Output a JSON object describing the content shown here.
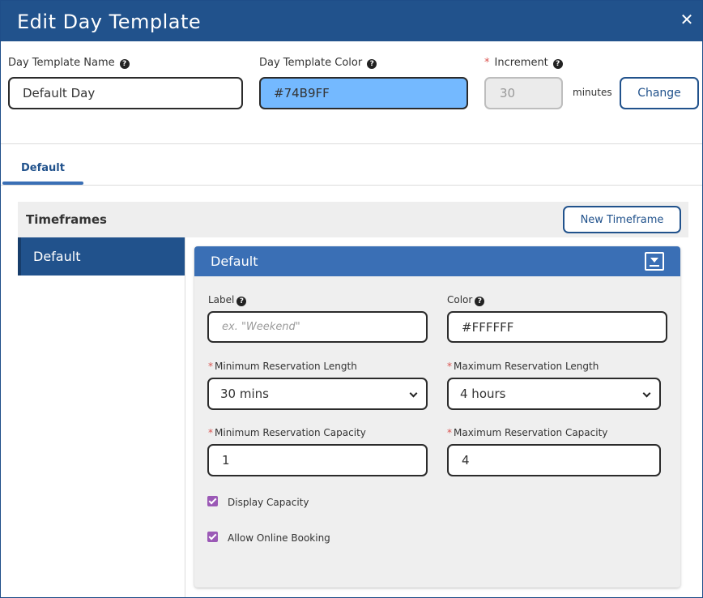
{
  "header": {
    "title": "Edit Day Template",
    "close_glyph": "✕"
  },
  "form": {
    "name_label": "Day Template Name",
    "name_value": "Default Day",
    "color_label": "Day Template Color",
    "color_value": "#74B9FF",
    "increment_label": "Increment",
    "increment_value": "30",
    "increment_unit": "minutes",
    "change_button": "Change",
    "help_glyph": "?"
  },
  "tabs": [
    {
      "label": "Default",
      "active": true
    }
  ],
  "timeframes": {
    "title": "Timeframes",
    "new_button": "New Timeframe",
    "items": [
      {
        "label": "Default",
        "selected": true
      }
    ]
  },
  "panel": {
    "title": "Default",
    "label_field": {
      "label": "Label",
      "placeholder": "ex. \"Weekend\""
    },
    "color_field": {
      "label": "Color",
      "value": "#FFFFFF"
    },
    "min_length": {
      "label": "Minimum Reservation Length",
      "value": "30 mins"
    },
    "max_length": {
      "label": "Maximum Reservation Length",
      "value": "4 hours"
    },
    "min_capacity": {
      "label": "Minimum Reservation Capacity",
      "value": "1"
    },
    "max_capacity": {
      "label": "Maximum Reservation Capacity",
      "value": "4"
    },
    "display_capacity": {
      "label": "Display Capacity",
      "checked": true
    },
    "allow_online_booking": {
      "label": "Allow Online Booking",
      "checked": true
    }
  },
  "colors": {
    "header_bg": "#21528C",
    "panel_head_bg": "#3A6FB5",
    "template_color": "#74B9FF",
    "checkbox": "#9B59B6",
    "required": "#D9534F"
  }
}
